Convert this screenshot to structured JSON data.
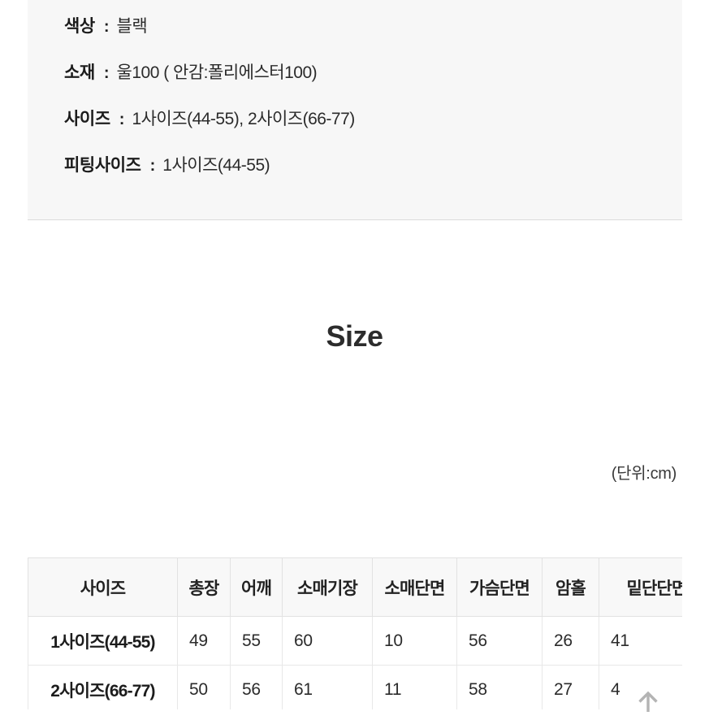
{
  "spec": {
    "rows": [
      {
        "label": "색상",
        "separator": ":",
        "value": "블랙"
      },
      {
        "label": "소재",
        "separator": ":",
        "value": "울100 ( 안감:폴리에스터100)"
      },
      {
        "label": "사이즈",
        "separator": ":",
        "value": "1사이즈(44-55), 2사이즈(66-77)"
      },
      {
        "label": "피팅사이즈",
        "separator": ":",
        "value": "1사이즈(44-55)"
      }
    ]
  },
  "size_section": {
    "heading": "Size",
    "unit_note": "(단위:cm)",
    "table": {
      "headers": [
        "사이즈",
        "총장",
        "어깨",
        "소매기장",
        "소매단면",
        "가슴단면",
        "암홀",
        "밑단단면"
      ],
      "rows": [
        {
          "name": "1사이즈(44-55)",
          "values": [
            "49",
            "55",
            "60",
            "10",
            "56",
            "26",
            "41"
          ]
        },
        {
          "name": "2사이즈(66-77)",
          "values": [
            "50",
            "56",
            "61",
            "11",
            "58",
            "27",
            "4"
          ]
        }
      ]
    }
  },
  "scroll_top": {
    "icon": "arrow-up-icon",
    "color": "#b4b4b4"
  }
}
